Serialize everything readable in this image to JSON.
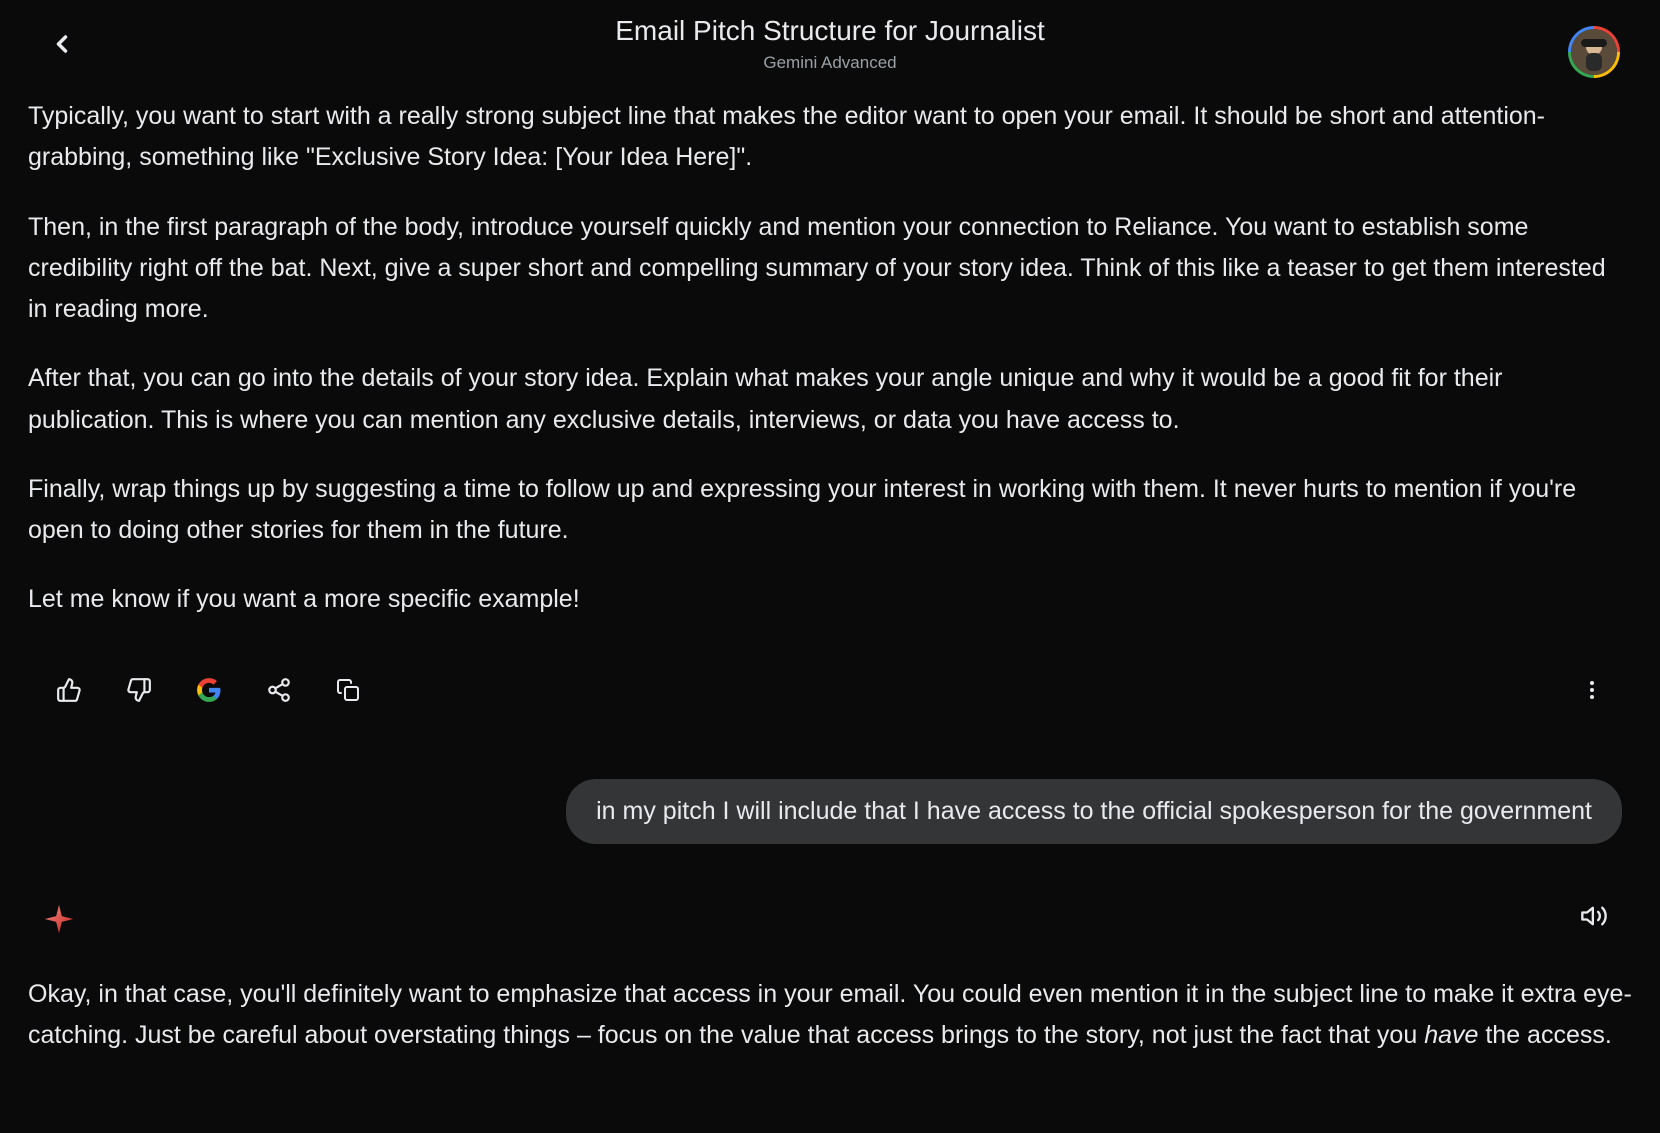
{
  "header": {
    "title": "Email Pitch Structure for Journalist",
    "subtitle": "Gemini Advanced"
  },
  "assistant1": {
    "p1": "Typically, you want to start with a really strong subject line that makes the editor want to open your email. It should be short and attention-grabbing, something like \"Exclusive Story Idea: [Your Idea Here]\".",
    "p2": "Then, in the first paragraph of the body, introduce yourself quickly and mention your connection to Reliance. You want to establish some credibility right off the bat. Next, give a super short and compelling summary of your story idea. Think of this like a teaser to get them interested in reading more.",
    "p3": "After that, you can go into the details of your story idea. Explain what makes your angle unique and why it would be a good fit for their publication. This is where you can mention any exclusive details, interviews, or data you have access to.",
    "p4": "Finally, wrap things up by suggesting a time to follow up and expressing your interest in working with them. It never hurts to mention if you're open to doing other stories for them in the future.",
    "p5": "Let me know if you want a more specific example!"
  },
  "user": {
    "text": "in my pitch I will include that I have access to the official spokesperson for the government"
  },
  "assistant2": {
    "pre": "Okay, in that case, you'll definitely want to emphasize that access in your email. You could even mention it in the subject line to make it extra eye-catching. Just be careful about overstating things – focus on the value that access brings to the story, not just the fact that you ",
    "em": "have",
    "post": " the access."
  },
  "icons": {
    "back": "back-icon",
    "thumbs_up": "thumbs-up-icon",
    "thumbs_down": "thumbs-down-icon",
    "google": "google-icon",
    "share": "share-icon",
    "copy": "copy-icon",
    "more": "more-icon",
    "spark": "spark-icon",
    "speaker": "speaker-icon",
    "avatar": "user-avatar"
  }
}
